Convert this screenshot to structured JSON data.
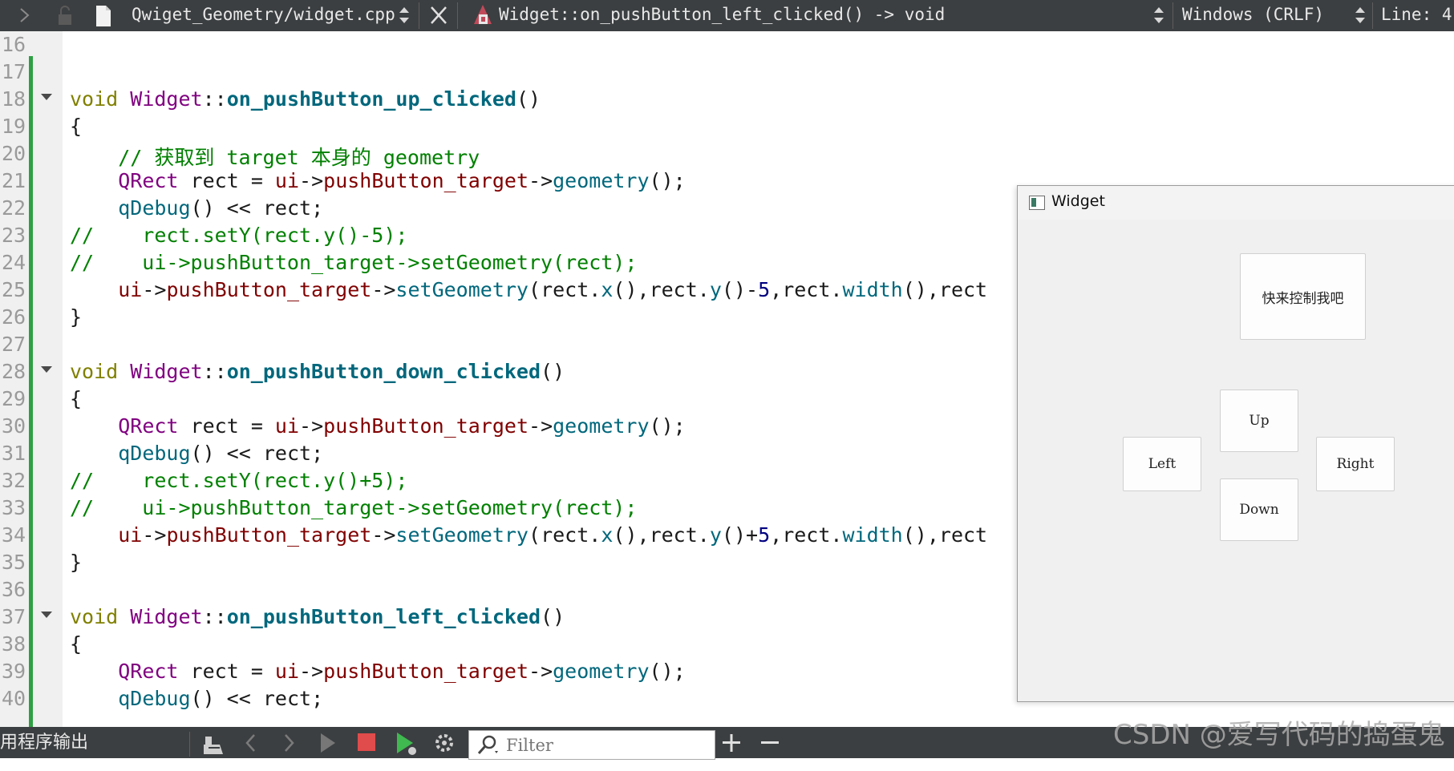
{
  "toolbar": {
    "file_name": "Qwiget_Geometry/widget.cpp",
    "symbol": "Widget::on_pushButton_left_clicked() -> void",
    "line_ending": "Windows (CRLF)",
    "line_position": "Line: 4"
  },
  "editor": {
    "line_numbers": [
      "16",
      "17",
      "18",
      "19",
      "20",
      "21",
      "22",
      "23",
      "24",
      "25",
      "26",
      "27",
      "28",
      "29",
      "30",
      "31",
      "32",
      "33",
      "34",
      "35",
      "36",
      "37",
      "38",
      "39",
      "40"
    ],
    "fold_markers_at_lines": [
      "18",
      "28",
      "37"
    ],
    "lines": {
      "l18": [
        "void",
        "Widget",
        "::",
        "on_pushButton_up_clicked",
        "()"
      ],
      "l19": "{",
      "l20": "    // 获取到 target 本身的 geometry",
      "l21": [
        "    ",
        "QRect",
        " ",
        "rect",
        " = ",
        "ui",
        "->",
        "pushButton_target",
        "->",
        "geometry",
        "();"
      ],
      "l22": [
        "    ",
        "qDebug",
        "() << ",
        "rect",
        ";"
      ],
      "l23": "//    rect.setY(rect.y()-5);",
      "l24": "//    ui->pushButton_target->setGeometry(rect);",
      "l25": [
        "    ",
        "ui",
        "->",
        "pushButton_target",
        "->",
        "setGeometry",
        "(",
        "rect",
        ".",
        "x",
        "(),",
        "rect",
        ".",
        "y",
        "()-",
        "5",
        ",",
        "rect",
        ".",
        "width",
        "(),",
        "rect"
      ],
      "l26": "}",
      "l28": [
        "void",
        "Widget",
        "::",
        "on_pushButton_down_clicked",
        "()"
      ],
      "l29": "{",
      "l30": [
        "    ",
        "QRect",
        " ",
        "rect",
        " = ",
        "ui",
        "->",
        "pushButton_target",
        "->",
        "geometry",
        "();"
      ],
      "l31": [
        "    ",
        "qDebug",
        "() << ",
        "rect",
        ";"
      ],
      "l32": "//    rect.setY(rect.y()+5);",
      "l33": "//    ui->pushButton_target->setGeometry(rect);",
      "l34": [
        "    ",
        "ui",
        "->",
        "pushButton_target",
        "->",
        "setGeometry",
        "(",
        "rect",
        ".",
        "x",
        "(),",
        "rect",
        ".",
        "y",
        "()+",
        "5",
        ",",
        "rect",
        ".",
        "width",
        "(),",
        "rect"
      ],
      "l35": "}",
      "l37": [
        "void",
        "Widget",
        "::",
        "on_pushButton_left_clicked",
        "()"
      ],
      "l38": "{",
      "l39": [
        "    ",
        "QRect",
        " ",
        "rect",
        " = ",
        "ui",
        "->",
        "pushButton_target",
        "->",
        "geometry",
        "();"
      ],
      "l40": [
        "    ",
        "qDebug",
        "() << ",
        "rect",
        ";"
      ]
    }
  },
  "widget_window": {
    "title": "Widget",
    "target_button": "快来控制我吧",
    "up_button": "Up",
    "left_button": "Left",
    "right_button": "Right",
    "down_button": "Down"
  },
  "output_bar": {
    "title": "用程序输出",
    "filter_placeholder": "Filter"
  },
  "watermark": "CSDN @爱写代码的捣蛋鬼",
  "colors": {
    "toolbar_bg": "#3c3f41",
    "change_bar": "#2ea043",
    "keyword": "#808000",
    "class": "#800080",
    "function": "#00677c",
    "member": "#800000",
    "comment": "#008000",
    "stop_button": "#e04b4b",
    "run_button": "#3fb950"
  }
}
